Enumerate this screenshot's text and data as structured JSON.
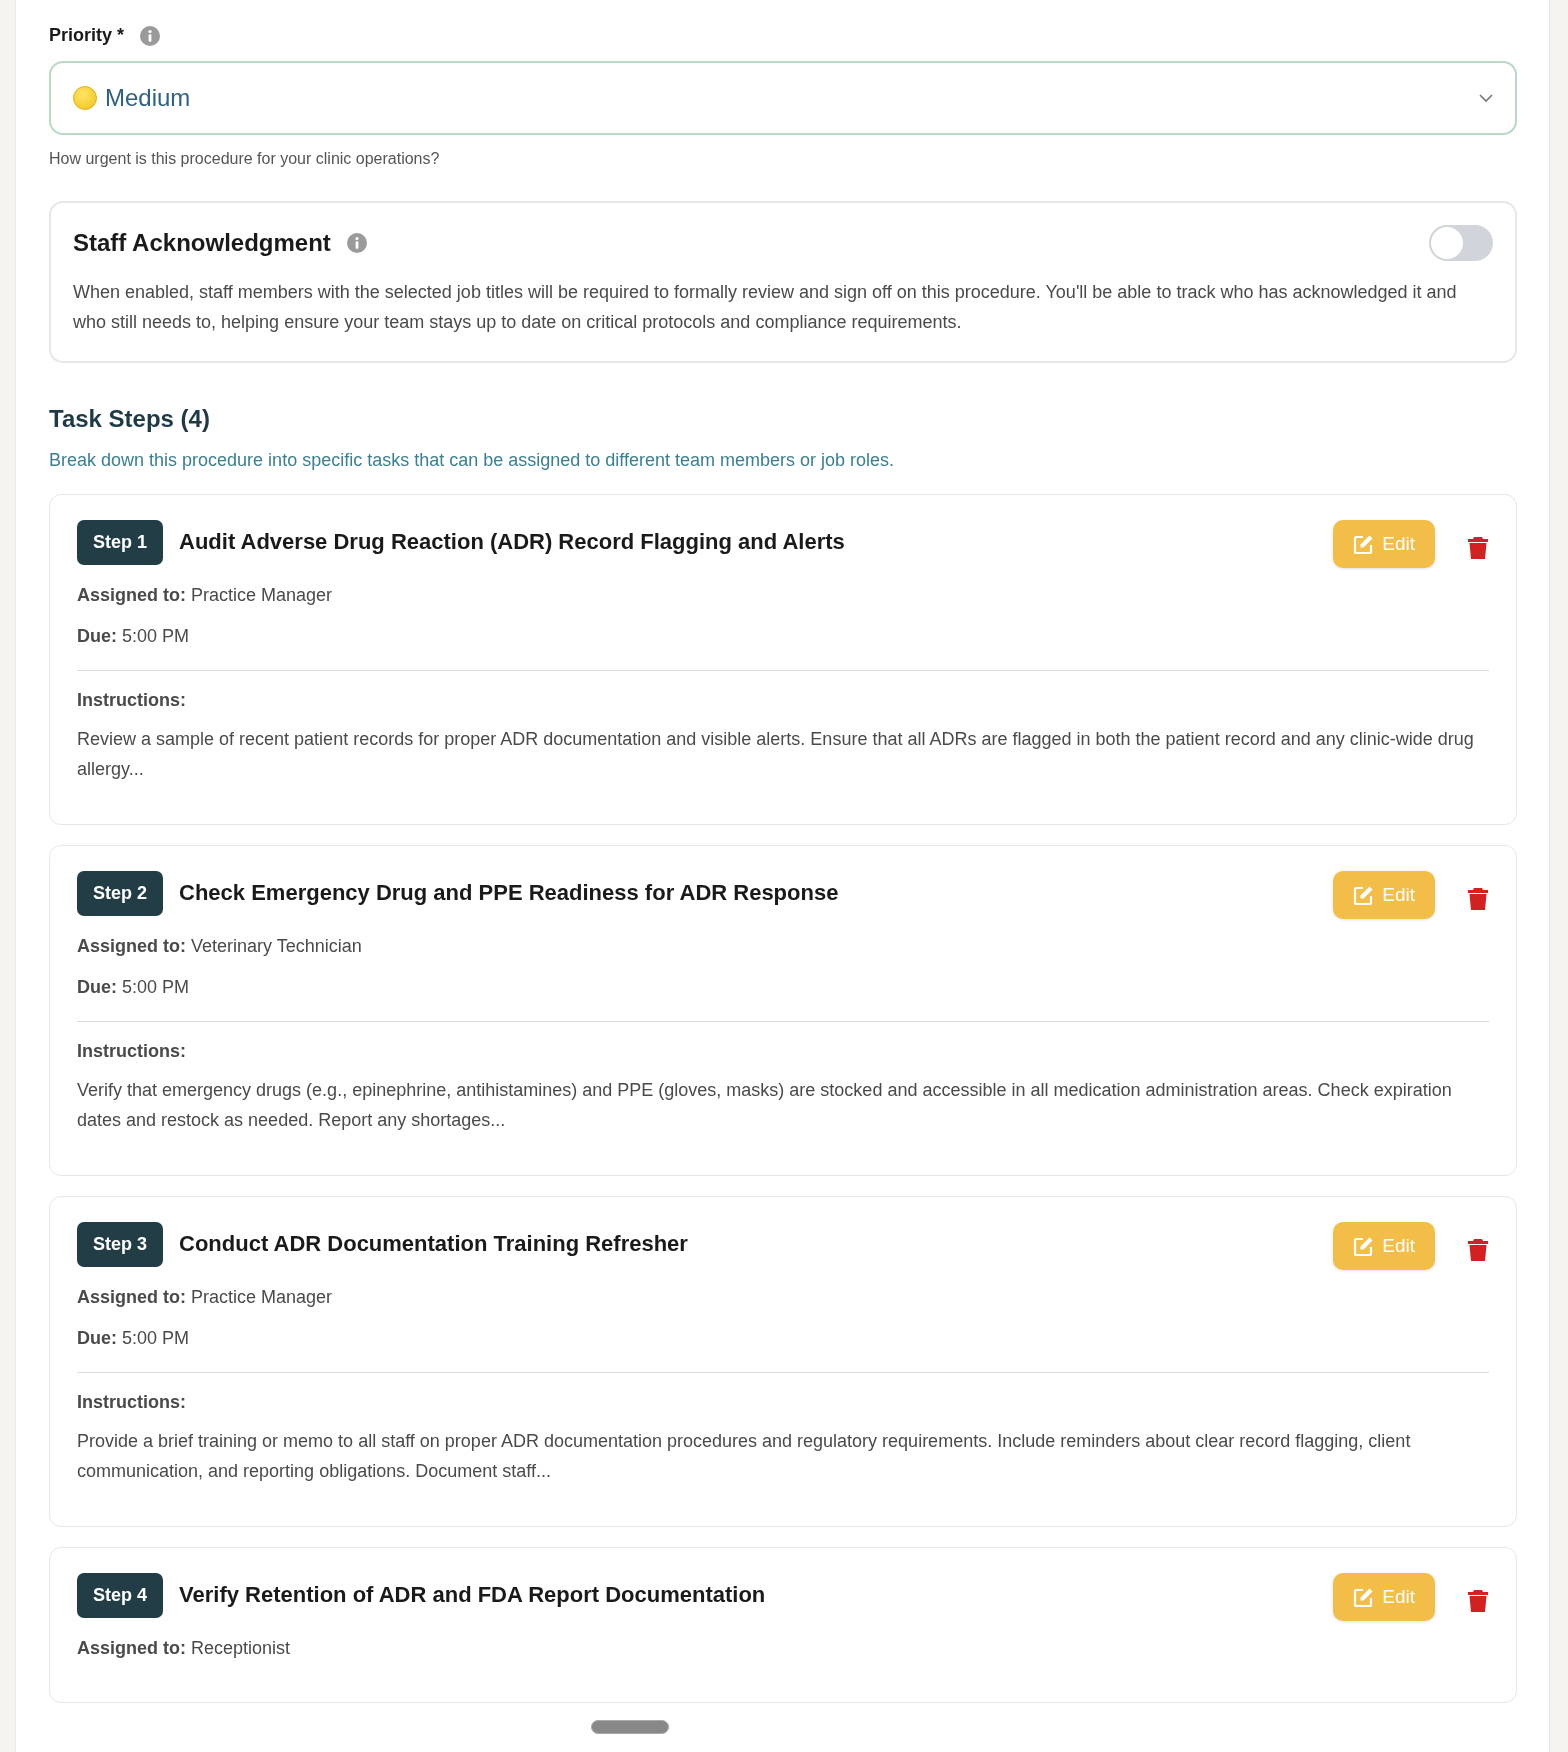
{
  "priority": {
    "label": "Priority *",
    "value": "Medium",
    "help": "How urgent is this procedure for your clinic operations?"
  },
  "staff_acknowledgment": {
    "title": "Staff Acknowledgment",
    "on": false,
    "description": "When enabled, staff members with the selected job titles will be required to formally review and sign off on this procedure. You'll be able to track who has acknowledged it and who still needs to, helping ensure your team stays up to date on critical protocols and compliance requirements."
  },
  "task_steps": {
    "heading": "Task Steps (4)",
    "subtitle": "Break down this procedure into specific tasks that can be assigned to different team members or job roles.",
    "steps": [
      {
        "badge": "Step 1",
        "title": "Audit Adverse Drug Reaction (ADR) Record Flagging and Alerts",
        "edit": "Edit",
        "assigned_label": "Assigned to:",
        "assigned_to": "Practice Manager",
        "due_label": "Due:",
        "due": "5:00 PM",
        "instructions_label": "Instructions:",
        "instructions": "Review a sample of recent patient records for proper ADR documentation and visible alerts. Ensure that all ADRs are flagged in both the patient record and any clinic-wide drug allergy..."
      },
      {
        "badge": "Step 2",
        "title": "Check Emergency Drug and PPE Readiness for ADR Response",
        "edit": "Edit",
        "assigned_label": "Assigned to:",
        "assigned_to": "Veterinary Technician",
        "due_label": "Due:",
        "due": "5:00 PM",
        "instructions_label": "Instructions:",
        "instructions": "Verify that emergency drugs (e.g., epinephrine, antihistamines) and PPE (gloves, masks) are stocked and accessible in all medication administration areas. Check expiration dates and restock as needed. Report any shortages..."
      },
      {
        "badge": "Step 3",
        "title": "Conduct ADR Documentation Training Refresher",
        "edit": "Edit",
        "assigned_label": "Assigned to:",
        "assigned_to": "Practice Manager",
        "due_label": "Due:",
        "due": "5:00 PM",
        "instructions_label": "Instructions:",
        "instructions": "Provide a brief training or memo to all staff on proper ADR documentation procedures and regulatory requirements. Include reminders about clear record flagging, client communication, and reporting obligations. Document staff..."
      },
      {
        "badge": "Step 4",
        "title": "Verify Retention of ADR and FDA Report Documentation",
        "edit": "Edit",
        "assigned_label": "Assigned to:",
        "assigned_to": "Receptionist"
      }
    ]
  }
}
